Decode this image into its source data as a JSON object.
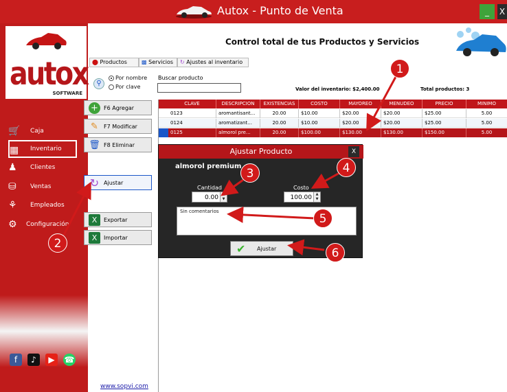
{
  "window": {
    "title": "Autox - Punto de Venta",
    "min_label": "_",
    "close_label": "X"
  },
  "logo": {
    "text": "autox",
    "sub": "SOFTWARE"
  },
  "sidebar": {
    "items": [
      {
        "label": "Caja",
        "icon": "cart-icon"
      },
      {
        "label": "Inventario",
        "icon": "inventory-icon"
      },
      {
        "label": "Clientes",
        "icon": "person-icon"
      },
      {
        "label": "Ventas",
        "icon": "sales-icon"
      },
      {
        "label": "Empleados",
        "icon": "employees-icon"
      },
      {
        "label": "Configuración",
        "icon": "gear-icon"
      }
    ],
    "url": "www.sopvi.com"
  },
  "header": {
    "title": "Control total de tus Productos y Servicios"
  },
  "tabs": [
    {
      "label": "Productos"
    },
    {
      "label": "Servicios"
    },
    {
      "label": "Ajustes al inventario"
    }
  ],
  "search": {
    "radio_name": "Por nombre",
    "radio_key": "Por clave",
    "label": "Buscar producto",
    "value": ""
  },
  "stats": {
    "inventory_value": "Valor del inventario: $2,400.00",
    "total_products": "Total productos: 3"
  },
  "buttons": {
    "add": "F6 Agregar",
    "modify": "F7 Modificar",
    "delete": "F8 Eliminar",
    "adjust": "Ajustar",
    "export": "Exportar",
    "import": "Importar"
  },
  "table": {
    "headers": [
      "CLAVE",
      "DESCRIPCION",
      "EXISTENCIAS",
      "COSTO",
      "MAYOREO",
      "MENUDEO",
      "PRECIO",
      "MINIMO"
    ],
    "rows": [
      [
        "0123",
        "aromantisant...",
        "20.00",
        "$10.00",
        "$20.00",
        "$20.00",
        "$25.00",
        "5.00"
      ],
      [
        "0124",
        "aromatizant...",
        "20.00",
        "$10.00",
        "$20.00",
        "$20.00",
        "$25.00",
        "5.00"
      ],
      [
        "0125",
        "almorol pre...",
        "20.00",
        "$100.00",
        "$130.00",
        "$130.00",
        "$150.00",
        "5.00"
      ]
    ],
    "selected_index": 2
  },
  "dialog": {
    "title": "Ajustar Producto",
    "close_label": "X",
    "product": "almorol premium",
    "quantity_label": "Cantidad",
    "quantity_value": "0.00",
    "cost_label": "Costo",
    "cost_value": "100.00",
    "comment": "Sin comentarios",
    "submit": "Ajustar"
  },
  "callouts": [
    "1",
    "2",
    "3",
    "4",
    "5",
    "6"
  ],
  "colors": {
    "brand_red": "#c81e1e",
    "dialog_bg": "#262626",
    "selection_blue": "#1a56c8"
  }
}
